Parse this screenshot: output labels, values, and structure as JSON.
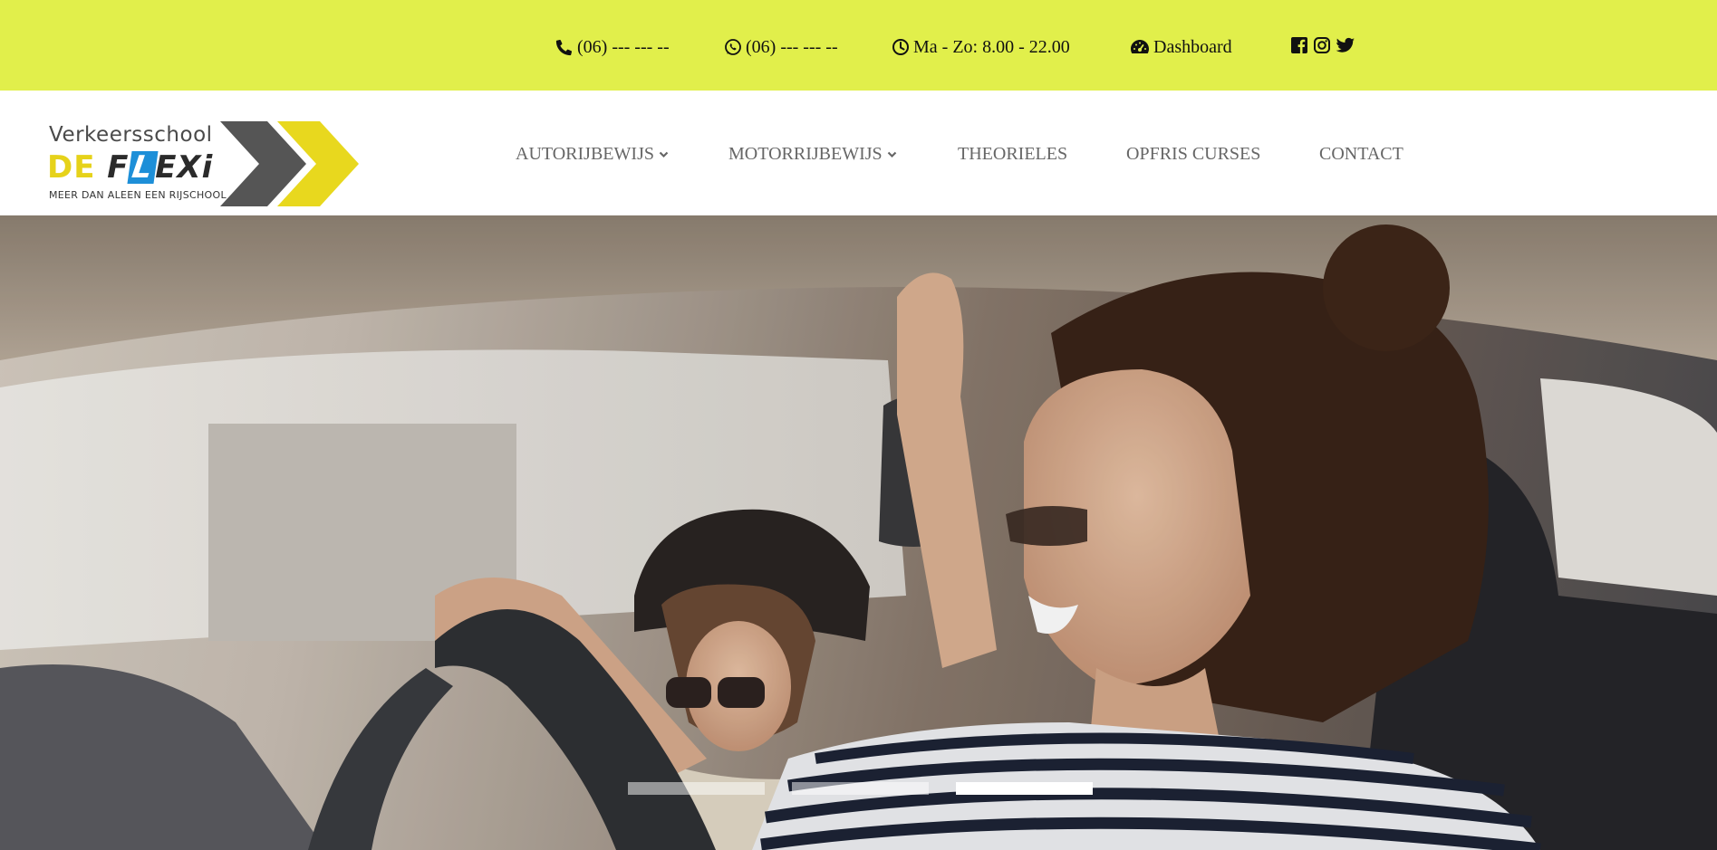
{
  "topbar": {
    "background": "#e1ef4b",
    "phone": {
      "icon": "phone-icon",
      "text": "(06) --- --- --"
    },
    "whatsapp": {
      "icon": "whatsapp-icon",
      "text": "(06) --- --- --"
    },
    "hours": {
      "icon": "clock-icon",
      "text": "Ma - Zo: 8.00 - 22.00"
    },
    "dashboard": {
      "icon": "dashboard-icon",
      "text": "Dashboard"
    },
    "social": [
      "facebook-icon",
      "instagram-icon",
      "twitter-icon"
    ]
  },
  "logo": {
    "line1": "Verkeersschool",
    "line2_de": "DE",
    "line2_f": "F",
    "line2_l": "L",
    "line2_rest": "EXi",
    "tagline": "MEER DAN ALEEN EEN RIJSCHOOL"
  },
  "nav": {
    "items": [
      {
        "label": "AUTORIJBEWIJS",
        "dropdown": true
      },
      {
        "label": "MOTORRIJBEWIJS",
        "dropdown": true
      },
      {
        "label": "THEORIELES",
        "dropdown": false
      },
      {
        "label": "OPFRIS CURSES",
        "dropdown": false
      },
      {
        "label": "CONTACT",
        "dropdown": false
      }
    ]
  },
  "hero": {
    "slides": 3,
    "active_slide": 3
  }
}
